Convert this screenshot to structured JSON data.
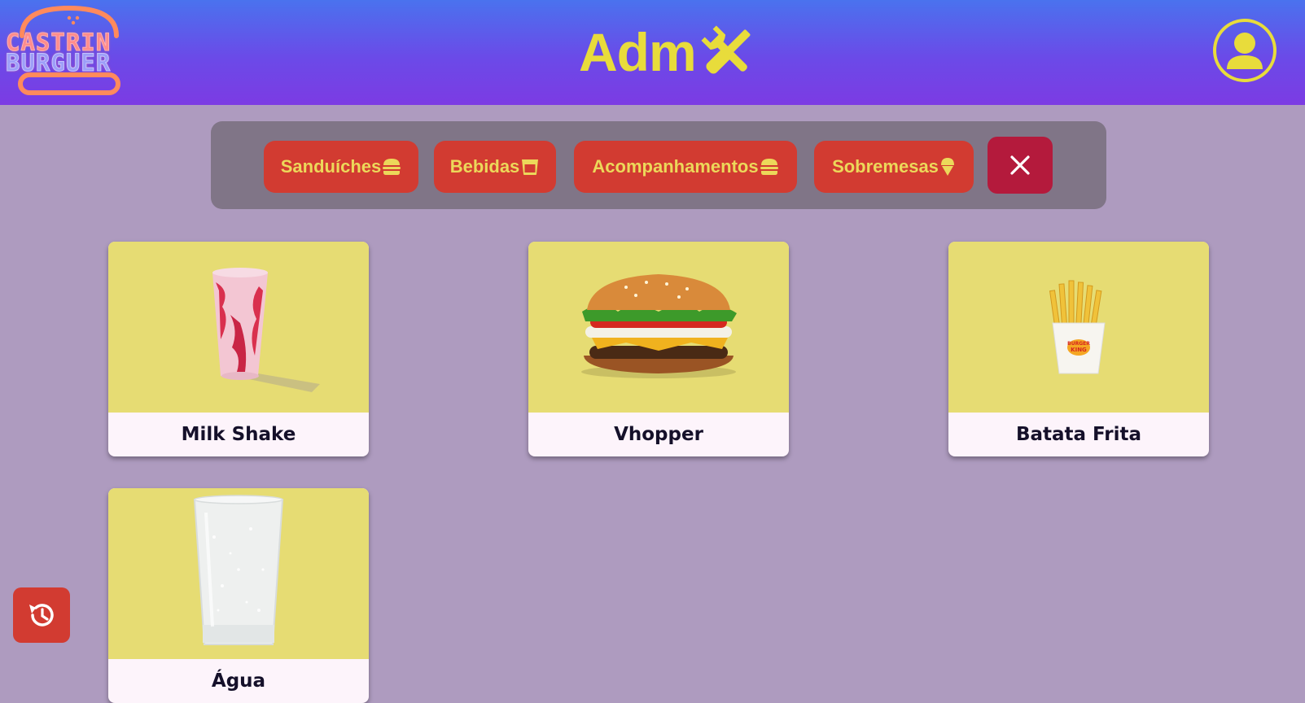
{
  "header": {
    "logo_line1": "CASTRIN",
    "logo_line2": "BURGUER",
    "title": "Adm",
    "title_icon": "tools-icon",
    "user_icon": "user-circle-icon"
  },
  "filters": [
    {
      "label": "Sanduíches",
      "icon": "burger-icon"
    },
    {
      "label": "Bebidas",
      "icon": "cup-icon"
    },
    {
      "label": "Acompanhamentos",
      "icon": "burger-icon"
    },
    {
      "label": "Sobremesas",
      "icon": "ice-cream-icon"
    }
  ],
  "close_icon": "close-icon",
  "products": [
    {
      "name": "Milk Shake",
      "image": "milkshake-image"
    },
    {
      "name": "Vhopper",
      "image": "burger-image"
    },
    {
      "name": "Batata Frita",
      "image": "fries-image"
    },
    {
      "name": "Água",
      "image": "water-cup-image"
    }
  ],
  "history_icon": "history-icon",
  "colors": {
    "header_top": "#4a72ee",
    "header_bottom": "#7c3be3",
    "background": "#ae9bbf",
    "accent_yellow": "#e8dc3b",
    "button_red": "#d23b31",
    "close_red": "#b41a3c",
    "card_image_bg": "#e6dc73"
  }
}
